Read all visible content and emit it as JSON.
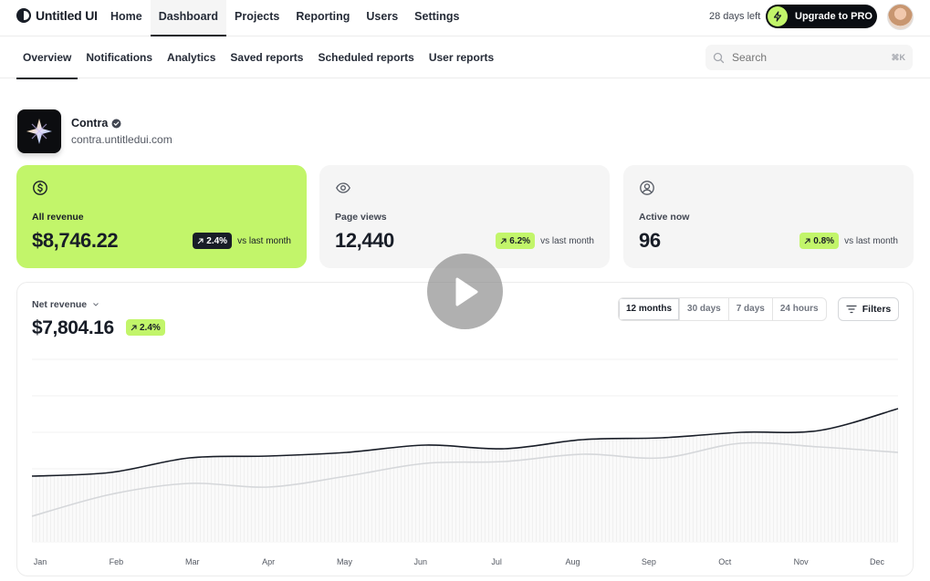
{
  "brand": {
    "name": "Untitled UI"
  },
  "nav": {
    "items": [
      "Home",
      "Dashboard",
      "Projects",
      "Reporting",
      "Users",
      "Settings"
    ],
    "active": 1
  },
  "trial": {
    "days_left": "28 days left",
    "upgrade_label": "Upgrade to PRO"
  },
  "subnav": {
    "tabs": [
      "Overview",
      "Notifications",
      "Analytics",
      "Saved reports",
      "Scheduled reports",
      "User reports"
    ],
    "active": 0
  },
  "search": {
    "placeholder": "Search",
    "shortcut": "⌘K"
  },
  "company": {
    "name": "Contra",
    "url": "contra.untitledui.com"
  },
  "kpis": [
    {
      "label": "All revenue",
      "value": "$8,746.22",
      "change": "2.4%",
      "compare": "vs last month",
      "icon": "dollar-circle-icon"
    },
    {
      "label": "Page views",
      "value": "12,440",
      "change": "6.2%",
      "compare": "vs last month",
      "icon": "eye-icon"
    },
    {
      "label": "Active now",
      "value": "96",
      "change": "0.8%",
      "compare": "vs last month",
      "icon": "user-circle-icon"
    }
  ],
  "revenue": {
    "label": "Net revenue",
    "value": "$7,804.16",
    "change": "2.4%"
  },
  "ranges": [
    "12 months",
    "30 days",
    "7 days",
    "24 hours"
  ],
  "range_active": 0,
  "filters_label": "Filters",
  "colors": {
    "accent": "#c2f56a",
    "dark": "#181d27",
    "grey_card": "#f5f5f5"
  },
  "chart_data": {
    "type": "line",
    "categories": [
      "Jan",
      "Feb",
      "Mar",
      "Apr",
      "May",
      "Jun",
      "Jul",
      "Aug",
      "Sep",
      "Oct",
      "Nov",
      "Dec"
    ],
    "series": [
      {
        "values": [
          0.36,
          0.38,
          0.46,
          0.47,
          0.49,
          0.53,
          0.51,
          0.56,
          0.57,
          0.6,
          0.61,
          0.73
        ]
      },
      {
        "values": [
          0.14,
          0.26,
          0.32,
          0.3,
          0.36,
          0.43,
          0.44,
          0.48,
          0.46,
          0.54,
          0.52,
          0.49
        ]
      }
    ],
    "ylim": [
      0,
      1
    ],
    "grid": true,
    "area_fill": true
  }
}
